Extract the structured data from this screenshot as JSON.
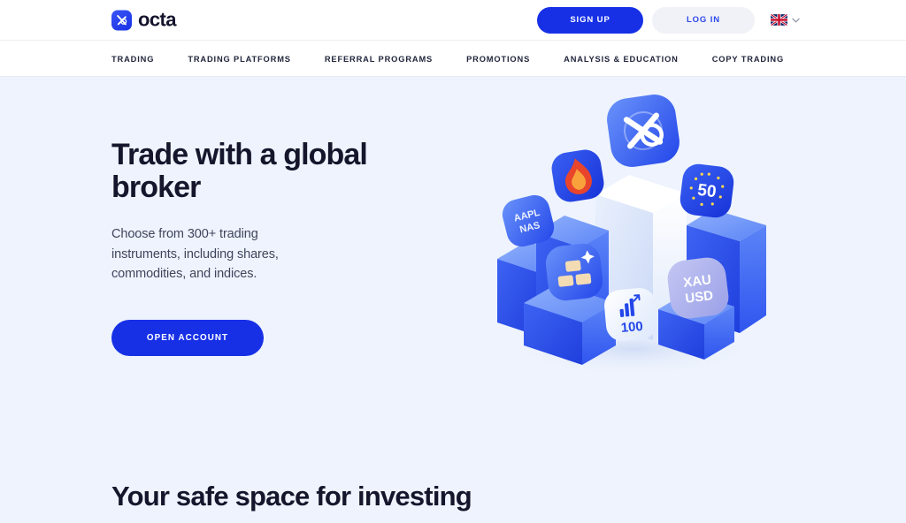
{
  "brand": {
    "name": "octa",
    "logo_icon": "octa-logo-mark",
    "accent_color": "#1730e6",
    "text_color": "#15162c"
  },
  "topbar": {
    "signup_label": "SIGN UP",
    "login_label": "LOG IN",
    "language": {
      "flag_icon": "uk-flag-icon",
      "chevron_icon": "chevron-down-icon"
    }
  },
  "nav": {
    "items": [
      {
        "label": "TRADING"
      },
      {
        "label": "TRADING PLATFORMS"
      },
      {
        "label": "REFERRAL PROGRAMS"
      },
      {
        "label": "PROMOTIONS"
      },
      {
        "label": "ANALYSIS & EDUCATION"
      },
      {
        "label": "COPY TRADING"
      }
    ]
  },
  "hero": {
    "title": "Trade with a global broker",
    "subtitle": "Choose from 300+ trading instruments, including shares, commodities, and indices.",
    "cta_label": "OPEN ACCOUNT",
    "background_color": "#eef3fd",
    "illustration": {
      "name": "trading-instruments-3d-illustration",
      "tiles": [
        {
          "id": "globe",
          "label": "",
          "icon": "globe-x-icon",
          "color": "#2f53f0"
        },
        {
          "id": "aapl",
          "label": "AAPL NAS",
          "icon": "stock-ticker-tile",
          "color": "#3f62f2"
        },
        {
          "id": "flame",
          "label": "",
          "icon": "flame-icon",
          "color": "#2344ea"
        },
        {
          "id": "gold",
          "label": "",
          "icon": "gold-bars-icon",
          "color": "#2f55f0"
        },
        {
          "id": "eu50",
          "label": "50",
          "icon": "eu-stars-icon",
          "color": "#3558f0"
        },
        {
          "id": "xauusd",
          "label": "XAU USD",
          "icon": "gold-pair-tile",
          "color": "#aeb4ef"
        },
        {
          "id": "n100",
          "label": "100",
          "icon": "chart-bars-icon",
          "color": "#f4f8ff"
        }
      ]
    }
  },
  "section2": {
    "title": "Your safe space for investing"
  }
}
